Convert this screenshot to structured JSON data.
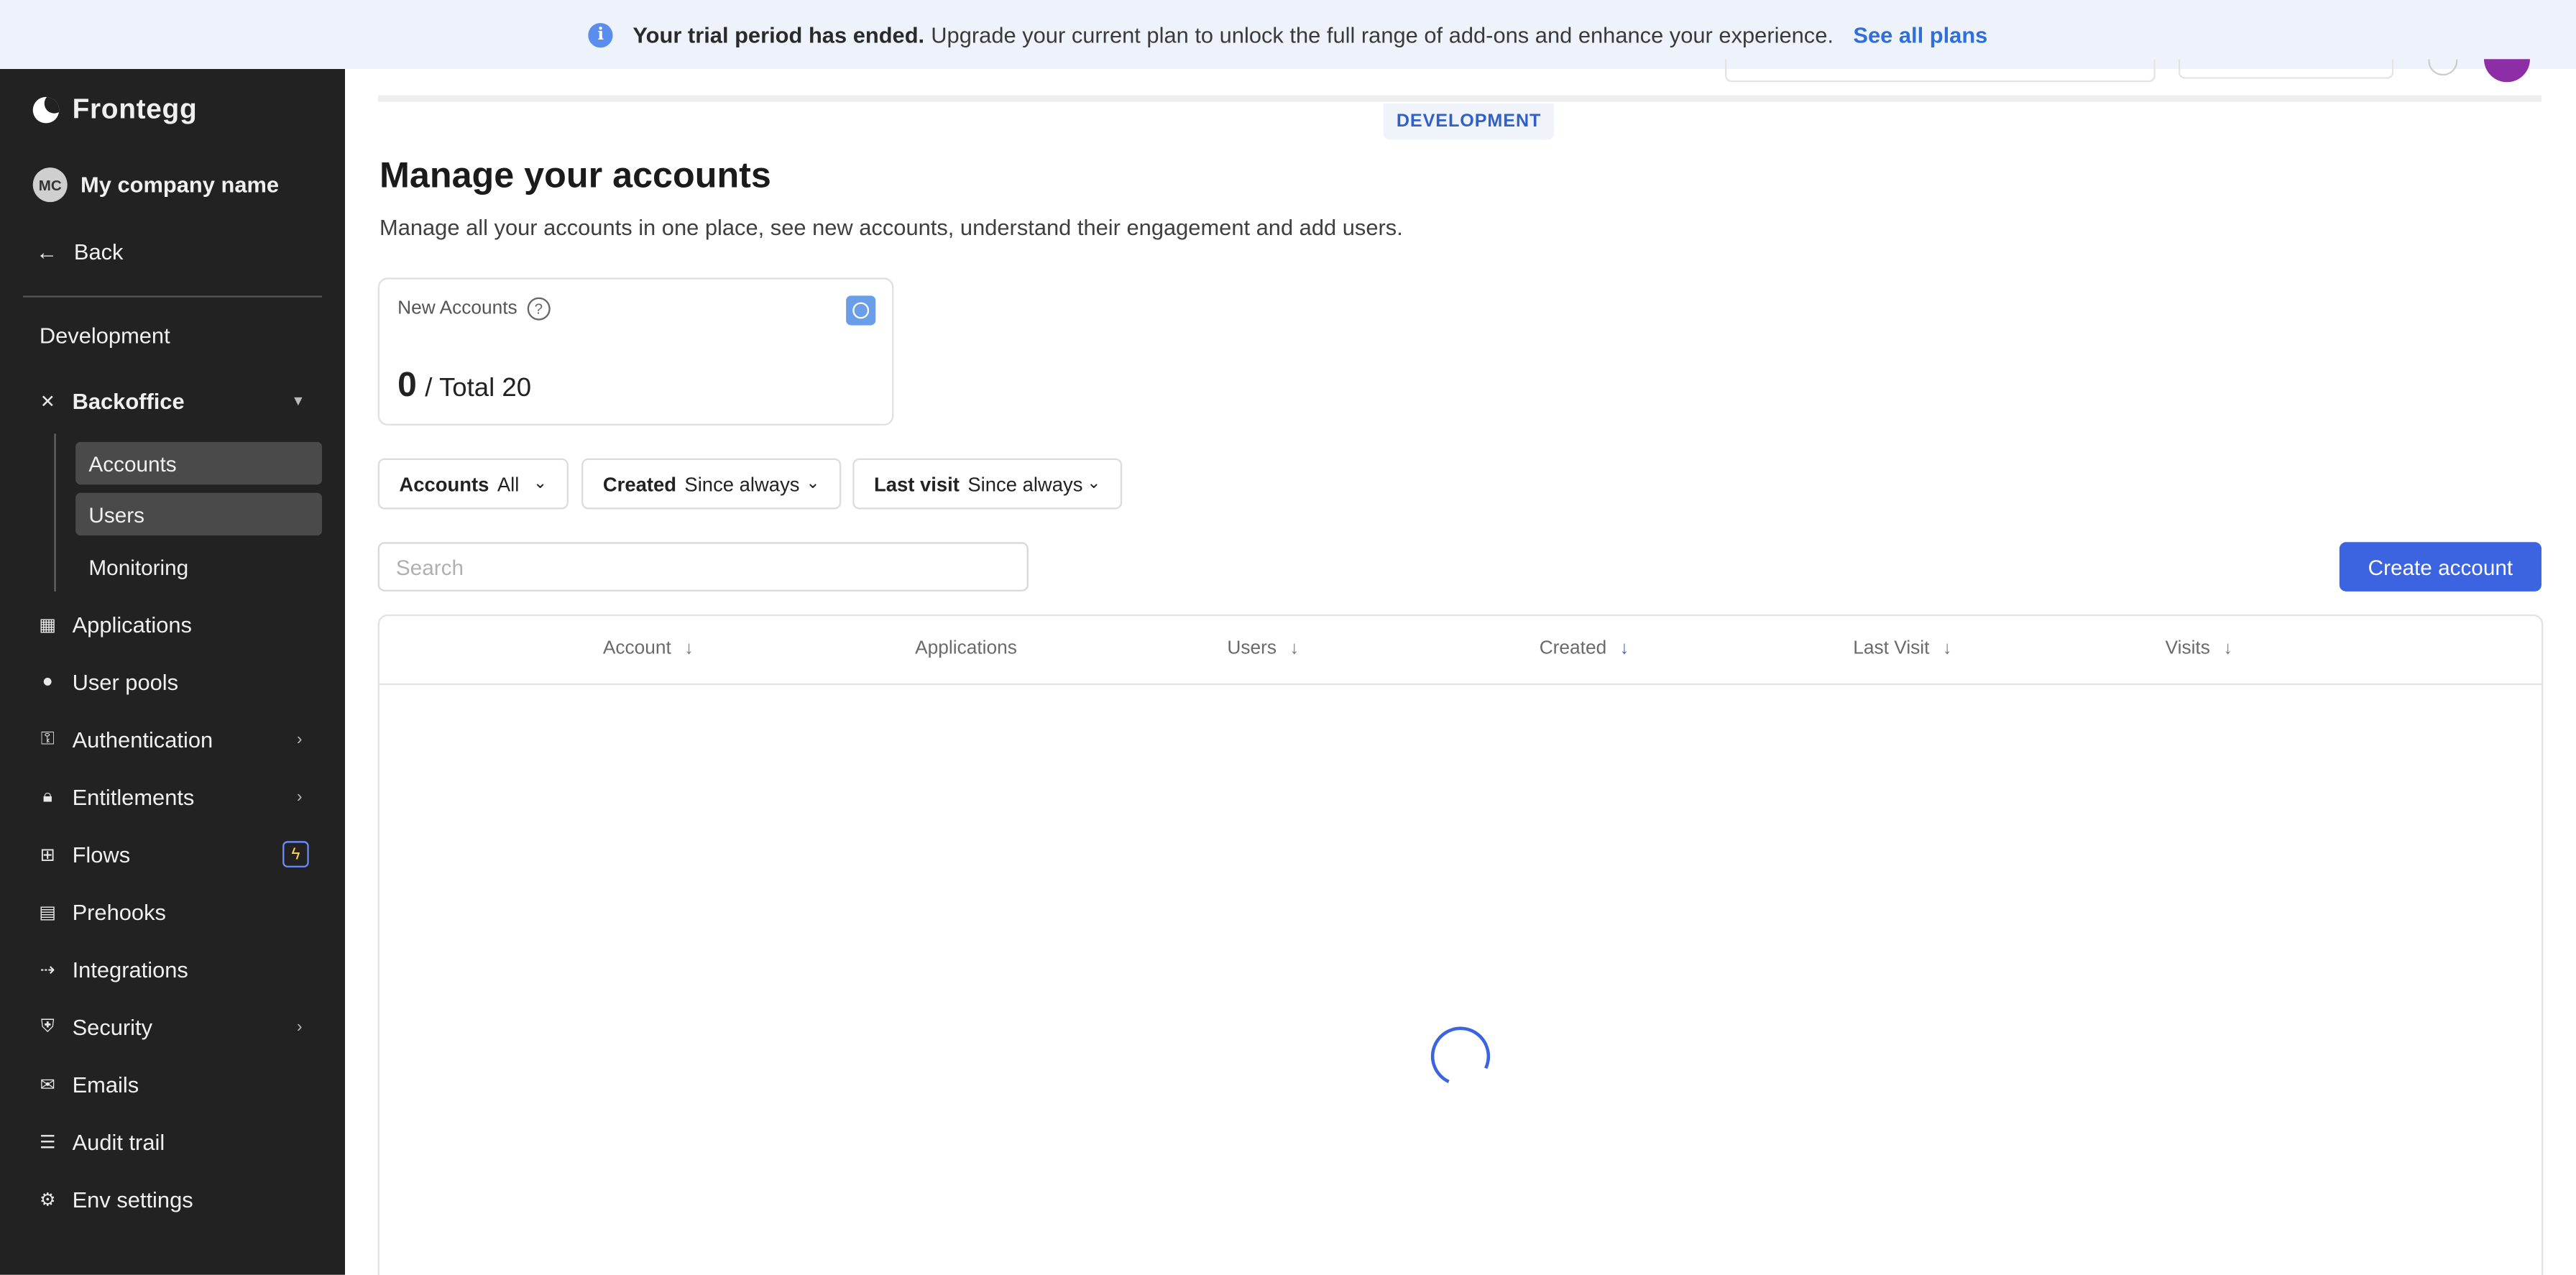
{
  "banner": {
    "bold_text": "Your trial period has ended.",
    "text": "Upgrade your current plan to unlock the full range of add-ons and enhance your experience.",
    "link": "See all plans"
  },
  "sidebar": {
    "brand": "Frontegg",
    "company": {
      "initials": "MC",
      "name": "My company name"
    },
    "back": "Back",
    "environment": "Development",
    "backoffice": {
      "label": "Backoffice",
      "subitems": [
        "Accounts",
        "Users",
        "Monitoring"
      ]
    },
    "items": [
      {
        "label": "Applications",
        "icon": "grid-icon"
      },
      {
        "label": "User pools",
        "icon": "users-icon"
      },
      {
        "label": "Authentication",
        "icon": "key-icon"
      },
      {
        "label": "Entitlements",
        "icon": "lock-icon"
      },
      {
        "label": "Flows",
        "icon": "flow-icon"
      },
      {
        "label": "Prehooks",
        "icon": "prehook-icon"
      },
      {
        "label": "Integrations",
        "icon": "plug-icon"
      },
      {
        "label": "Security",
        "icon": "shield-icon"
      },
      {
        "label": "Emails",
        "icon": "mail-icon"
      },
      {
        "label": "Audit trail",
        "icon": "list-icon"
      },
      {
        "label": "Env settings",
        "icon": "gear-icon"
      }
    ]
  },
  "main": {
    "env_badge": "DEVELOPMENT",
    "title": "Manage your accounts",
    "subtitle": "Manage all your accounts in one place, see new accounts, understand their engagement and add users.",
    "card": {
      "label": "New Accounts",
      "value": "0",
      "total": "/ Total 20"
    },
    "filters": [
      {
        "key": "Accounts",
        "value": "All"
      },
      {
        "key": "Created",
        "value": "Since always"
      },
      {
        "key": "Last visit",
        "value": "Since always"
      }
    ],
    "search_placeholder": "Search",
    "create_button": "Create account",
    "columns": [
      "Account",
      "Applications",
      "Users",
      "Created",
      "Last Visit",
      "Visits"
    ]
  },
  "colors": {
    "accent": "#3c63e0",
    "sidebar_bg": "#222222",
    "banner_bg": "#eef3fb"
  }
}
